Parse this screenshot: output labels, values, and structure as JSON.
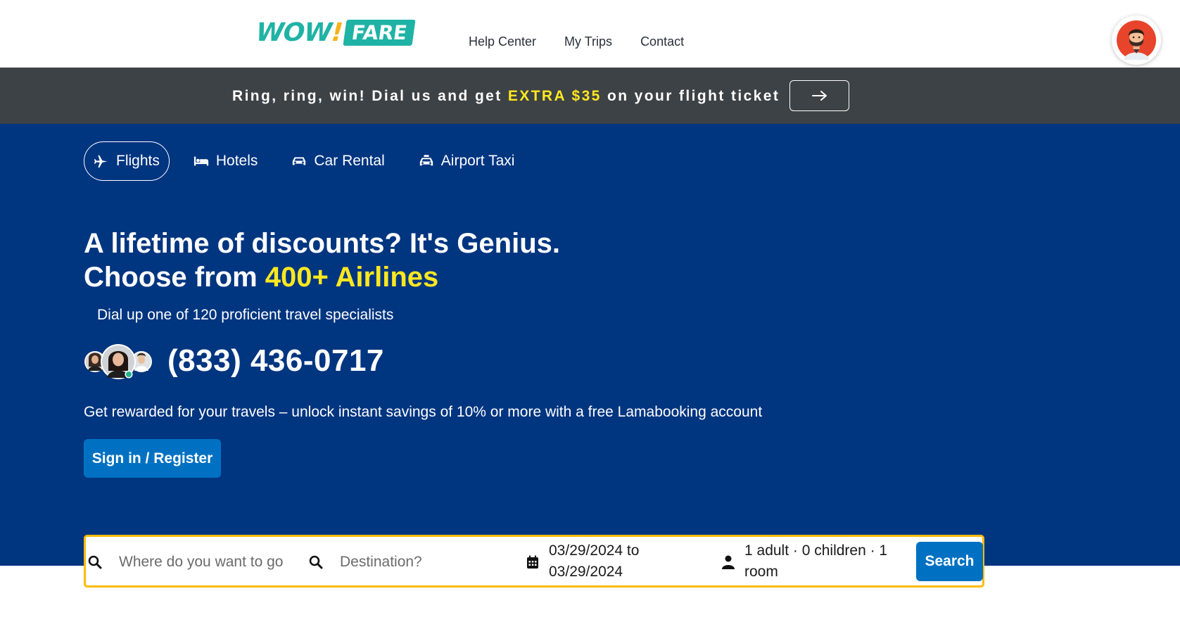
{
  "logo": {
    "wow": "WOW",
    "bang": "!",
    "fare": "FARE"
  },
  "nav": {
    "links": [
      "Help Center",
      "My Trips",
      "Contact"
    ]
  },
  "promo": {
    "text_before": "Ring, ring, win! Dial us and get ",
    "highlight": "EXTRA $35",
    "text_after": " on your flight ticket",
    "arrow": "→"
  },
  "tabs": [
    {
      "label": "Flights",
      "icon": "plane-icon",
      "active": true
    },
    {
      "label": "Hotels",
      "icon": "bed-icon",
      "active": false
    },
    {
      "label": "Car Rental",
      "icon": "car-icon",
      "active": false
    },
    {
      "label": "Airport Taxi",
      "icon": "taxi-icon",
      "active": false
    }
  ],
  "hero": {
    "headline_line1": "A lifetime of discounts? It's Genius.",
    "headline_line2_prefix": "Choose from ",
    "headline_line2_highlight": "400+ Airlines",
    "subheadline": "Dial up one of 120 proficient travel specialists",
    "phone": "(833) 436-0717",
    "reward_text": "Get rewarded for your travels – unlock instant savings of 10% or more with a free Lamabooking account",
    "signin_label": "Sign in / Register"
  },
  "search": {
    "origin_placeholder": "Where do you want to go",
    "destination_placeholder": "Destination?",
    "dates_line1": "03/29/2024 to",
    "dates_line2": "03/29/2024",
    "guests_line1": "1 adult · 0 children · 1",
    "guests_line2": "room",
    "button_label": "Search"
  },
  "colors": {
    "hero_bg": "#003580",
    "promo_bg": "#3d4246",
    "highlight": "#ffe81f",
    "primary_button": "#0071c2",
    "search_border": "#febb02",
    "logo_teal": "#1fb3a6"
  }
}
